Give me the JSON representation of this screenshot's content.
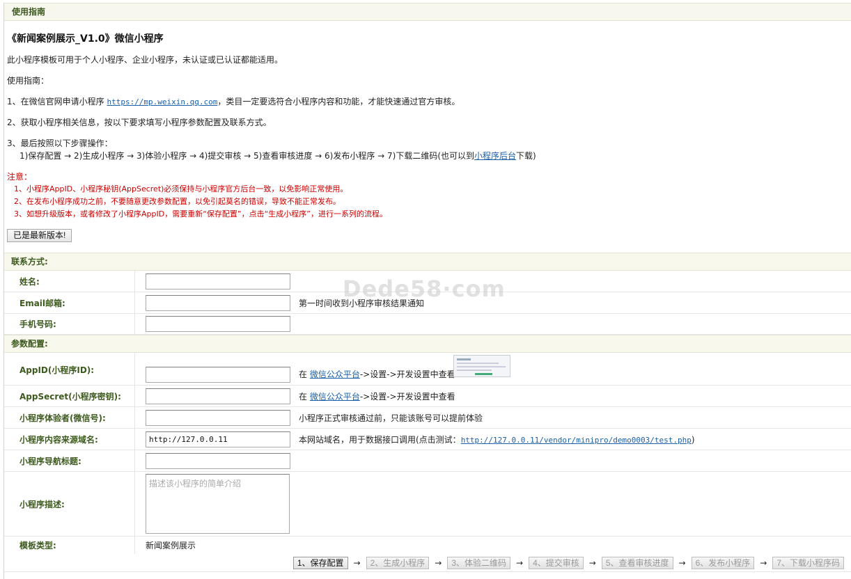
{
  "title_bar": "使用指南",
  "guide": {
    "heading": "《新闻案例展示_V1.0》微信小程序",
    "intro": "此小程序模板可用于个人小程序、企业小程序，未认证或已认证都能适用。",
    "guide_label": "使用指南：",
    "step1_prefix": "1、在微信官网申请小程序 ",
    "step1_link": "https://mp.weixin.qq.com",
    "step1_suffix": "，类目一定要选符合小程序内容和功能，才能快速通过官方审核。",
    "step2": "2、获取小程序相关信息，按以下要求填写小程序参数配置及联系方式。",
    "step3": "3、最后按照以下步骤操作：",
    "step3_detail_prefix": "1)保存配置 → 2)生成小程序 → 3)体验小程序 → 4)提交审核 → 5)查看审核进度 → 6)发布小程序 → 7)下载二维码(也可以到",
    "step3_detail_link": "小程序后台",
    "step3_detail_suffix": "下载)",
    "note_title": "注意：",
    "notes": [
      "1、小程序AppID、小程序秘钥(AppSecret)必须保持与小程序官方后台一致，以免影响正常使用。",
      "2、在发布小程序成功之前，不要随意更改参数配置，以免引起莫名的错误，导致不能正常发布。",
      "3、如想升级版本，或者修改了小程序AppID，需要重新“保存配置”，点击“生成小程序”，进行一系列的流程。"
    ],
    "version_button": "已是最新版本!"
  },
  "contact": {
    "section": "联系方式:",
    "name_label": "姓名:",
    "name_value": "",
    "email_label": "Email邮箱:",
    "email_value": "",
    "email_hint": "第一时间收到小程序审核结果通知",
    "phone_label": "手机号码:",
    "phone_value": ""
  },
  "params": {
    "section": "参数配置:",
    "appid_label": "AppID(小程序ID):",
    "appid_value": "",
    "appid_hint_prefix": "在 ",
    "appid_hint_link": "微信公众平台",
    "appid_hint_suffix": "->设置->开发设置中查看",
    "secret_label": "AppSecret(小程序密钥):",
    "secret_value": "",
    "secret_hint_prefix": "在 ",
    "secret_hint_link": "微信公众平台",
    "secret_hint_suffix": "->设置->开发设置中查看",
    "tester_label": "小程序体验者(微信号):",
    "tester_value": "",
    "tester_hint": "小程序正式审核通过前，只能该账号可以提前体验",
    "domain_label": "小程序内容来源域名:",
    "domain_value": "http://127.0.0.11",
    "domain_hint_prefix": "本网站域名，用于数据接口调用(点击测试：",
    "domain_hint_link": "http://127.0.0.11/vendor/minipro/demo0003/test.php",
    "domain_hint_suffix": ")",
    "nav_label": "小程序导航标题:",
    "nav_value": "",
    "desc_label": "小程序描述:",
    "desc_placeholder": "描述该小程序的简单介绍",
    "template_label": "模板类型:",
    "template_value": "新闻案例展示"
  },
  "watermark": "Dede58·com",
  "steps": {
    "arrow": "→",
    "buttons": [
      "1、保存配置",
      "2、生成小程序",
      "3、体验二维码",
      "4、提交审核",
      "5、查看审核进度",
      "6、发布小程序",
      "7、下载小程序码"
    ]
  },
  "colors": {
    "section_bg": "#f8f9ec",
    "label_text": "#3d5a1e",
    "link": "#1a5fa8",
    "note_red": "#cc0000"
  }
}
